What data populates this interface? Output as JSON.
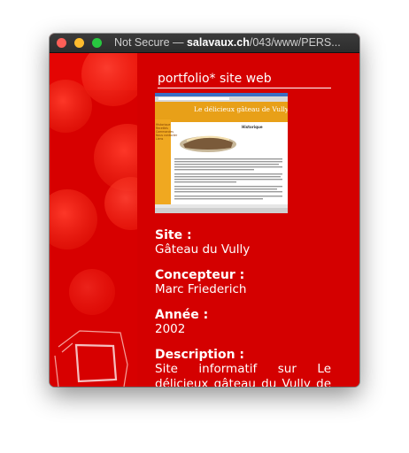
{
  "window": {
    "title_prefix": "Not Secure — ",
    "title_domain": "salavaux.ch",
    "title_path": "/043/www/PERS..."
  },
  "page": {
    "heading": "portfolio* site web",
    "thumbnail": {
      "site_title": "Le délicieux gâteau de Vully",
      "section_title": "Historique",
      "menu": [
        "Historique",
        "Recettes",
        "Commandes",
        "Nous contacter",
        "Liens"
      ]
    },
    "fields": [
      {
        "label": "Site :",
        "value": "Gâteau du Vully"
      },
      {
        "label": "Concepteur :",
        "value": "Marc Friederich"
      },
      {
        "label": "Année :",
        "value": "2002"
      },
      {
        "label": "Description :",
        "value": "Site informatif sur Le délicieux gâteau du Vully de la"
      }
    ]
  },
  "colors": {
    "page_red": "#d40000",
    "sidebar_red": "#d90000",
    "text": "#ffffff"
  }
}
